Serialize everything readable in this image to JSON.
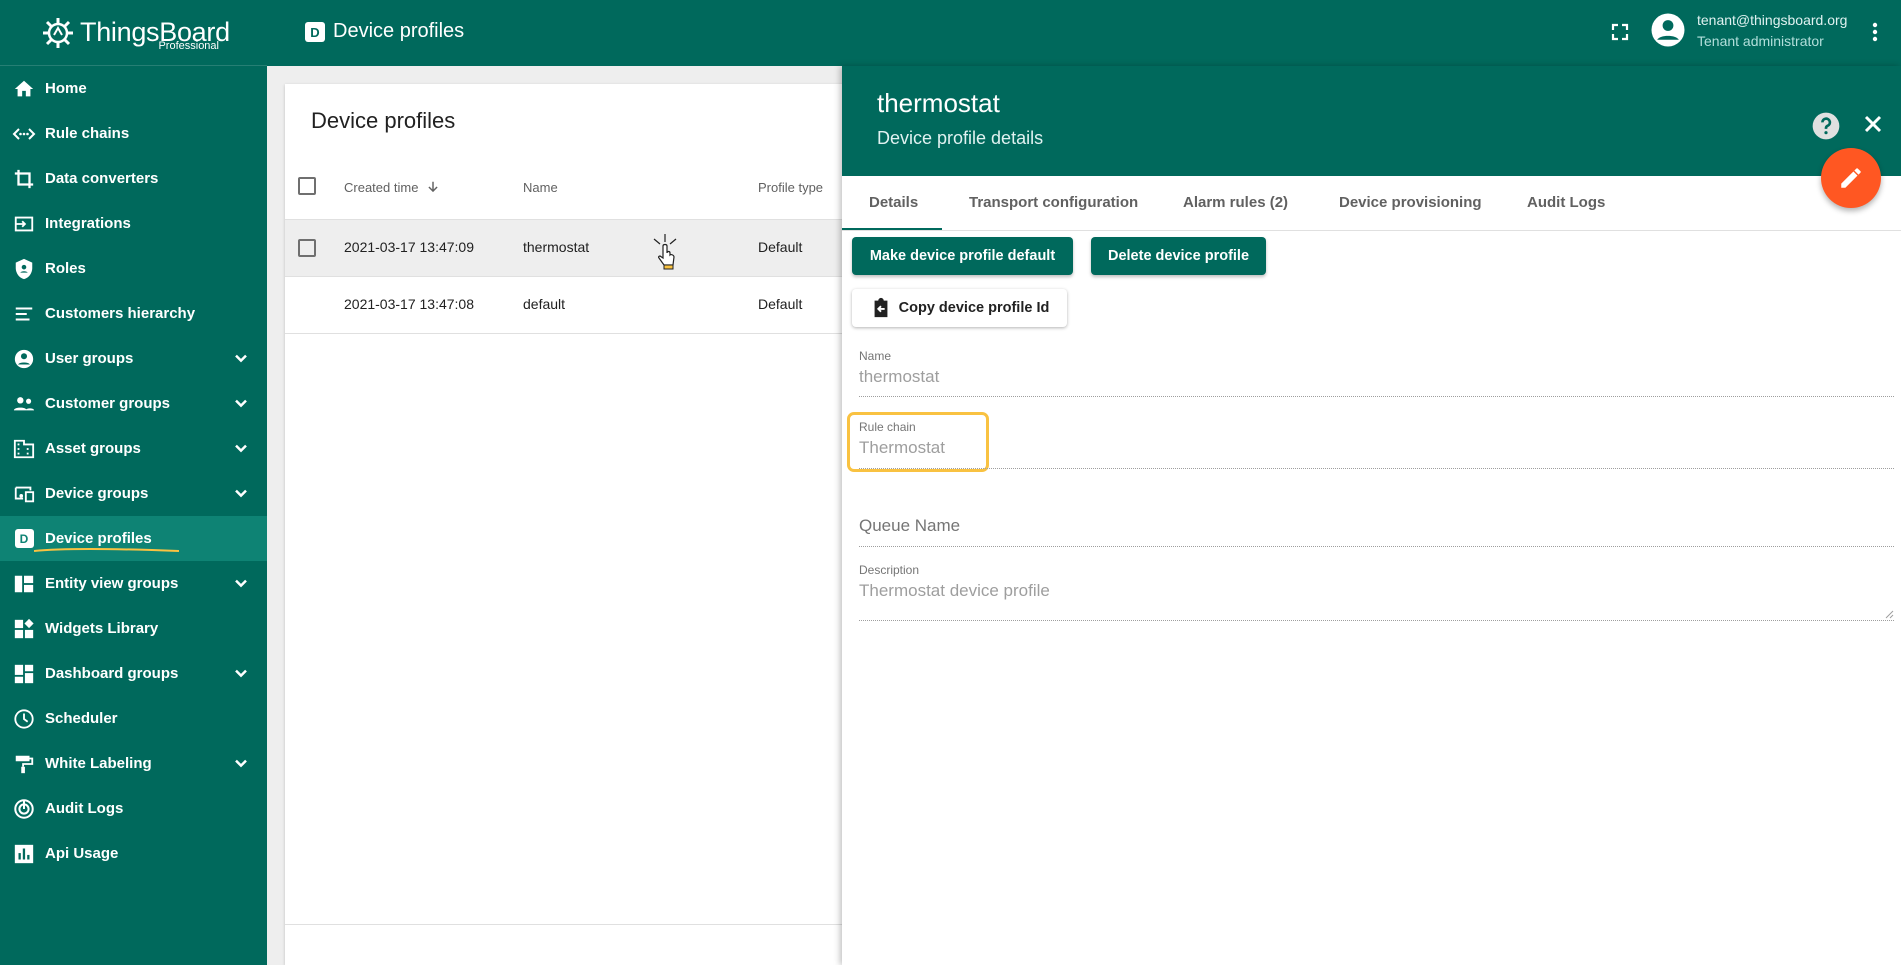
{
  "app": {
    "brand": "ThingsBoard",
    "edition": "Professional"
  },
  "sidebar": {
    "items": [
      {
        "label": "Home",
        "icon": "home-icon"
      },
      {
        "label": "Rule chains",
        "icon": "rule-chains-icon"
      },
      {
        "label": "Data converters",
        "icon": "data-converters-icon"
      },
      {
        "label": "Integrations",
        "icon": "integrations-icon"
      },
      {
        "label": "Roles",
        "icon": "roles-shield-icon"
      },
      {
        "label": "Customers hierarchy",
        "icon": "hierarchy-icon"
      },
      {
        "label": "User groups",
        "icon": "account-icon",
        "expandable": true
      },
      {
        "label": "Customer groups",
        "icon": "people-icon",
        "expandable": true
      },
      {
        "label": "Asset groups",
        "icon": "building-icon",
        "expandable": true
      },
      {
        "label": "Device groups",
        "icon": "devices-icon",
        "expandable": true
      },
      {
        "label": "Device profiles",
        "icon": "device-profile-icon",
        "active": true
      },
      {
        "label": "Entity view groups",
        "icon": "entity-view-icon",
        "expandable": true
      },
      {
        "label": "Widgets Library",
        "icon": "widgets-icon"
      },
      {
        "label": "Dashboard groups",
        "icon": "dashboard-icon",
        "expandable": true
      },
      {
        "label": "Scheduler",
        "icon": "clock-icon"
      },
      {
        "label": "White Labeling",
        "icon": "paint-roller-icon",
        "expandable": true
      },
      {
        "label": "Audit Logs",
        "icon": "audit-icon"
      },
      {
        "label": "Api Usage",
        "icon": "chart-icon"
      }
    ]
  },
  "topbar": {
    "page_icon_letter": "D",
    "page_title": "Device profiles",
    "user_email": "tenant@thingsboard.org",
    "user_role": "Tenant administrator"
  },
  "table": {
    "title": "Device profiles",
    "columns": [
      "Created time",
      "Name",
      "Profile type"
    ],
    "rows": [
      {
        "created": "2021-03-17 13:47:09",
        "name": "thermostat",
        "type": "Default",
        "selected": true
      },
      {
        "created": "2021-03-17 13:47:08",
        "name": "default",
        "type": "Default",
        "selected": false
      }
    ]
  },
  "details": {
    "title": "thermostat",
    "subtitle": "Device profile details",
    "tabs": [
      "Details",
      "Transport configuration",
      "Alarm rules (2)",
      "Device provisioning",
      "Audit Logs"
    ],
    "active_tab": 0,
    "buttons": {
      "make_default": "Make device profile default",
      "delete": "Delete device profile",
      "copy_id": "Copy device profile Id"
    },
    "fields": {
      "name_label": "Name",
      "name_value": "thermostat",
      "rule_chain_label": "Rule chain",
      "rule_chain_value": "Thermostat",
      "queue_label": "Queue Name",
      "description_label": "Description",
      "description_value": "Thermostat device profile"
    }
  },
  "colors": {
    "primary": "#00695c",
    "active_nav": "#0e8374",
    "accent_fab": "#ff5722",
    "highlight": "#f9c241"
  }
}
